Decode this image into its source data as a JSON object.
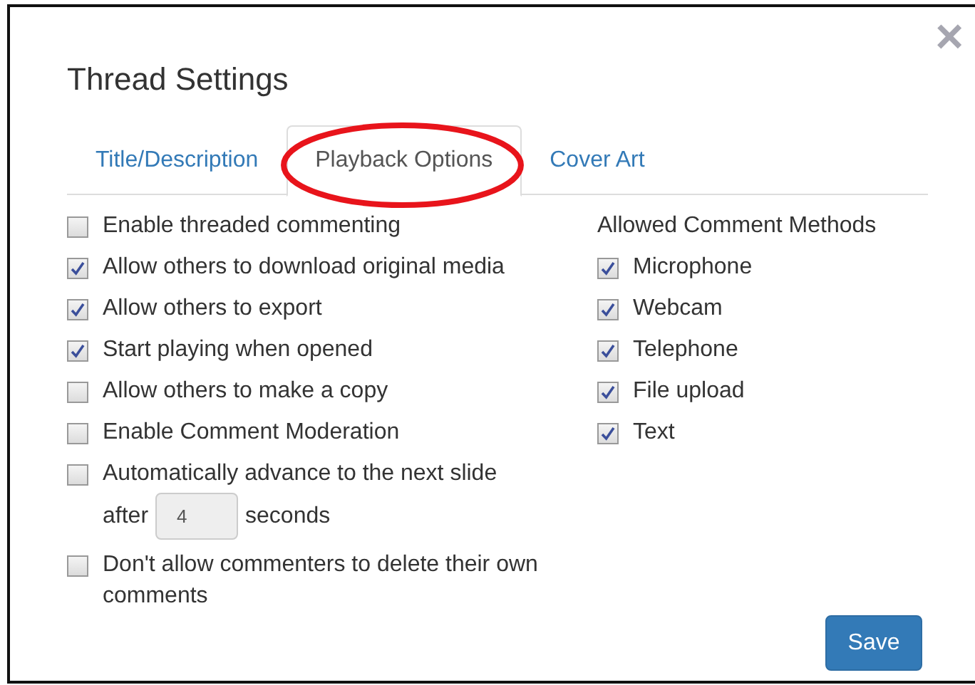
{
  "dialog": {
    "title": "Thread Settings",
    "close": "×"
  },
  "tabs": [
    {
      "label": "Title/Description",
      "selected": false,
      "circled": false
    },
    {
      "label": "Playback Options",
      "selected": true,
      "circled": true
    },
    {
      "label": "Cover Art",
      "selected": false,
      "circled": false
    }
  ],
  "options": [
    {
      "kind": "checkbox",
      "label": "Enable threaded commenting",
      "checked": false
    },
    {
      "kind": "checkbox",
      "label": "Allow others to download original media",
      "checked": true
    },
    {
      "kind": "checkbox",
      "label": "Allow others to export",
      "checked": true
    },
    {
      "kind": "checkbox",
      "label": "Start playing when opened",
      "checked": true
    },
    {
      "kind": "checkbox",
      "label": "Allow others to make a copy",
      "checked": false
    },
    {
      "kind": "checkbox",
      "label": "Enable Comment Moderation",
      "checked": false
    },
    {
      "kind": "interval",
      "label": "Automatically advance to the next slide",
      "before": "after",
      "value": "4",
      "after": "seconds",
      "checked": false
    },
    {
      "kind": "checkbox",
      "label": "Don't allow commenters to delete their own comments",
      "checked": false
    }
  ],
  "comment_methods": {
    "heading": "Allowed Comment Methods",
    "items": [
      {
        "label": "Microphone",
        "checked": true
      },
      {
        "label": "Webcam",
        "checked": true
      },
      {
        "label": "Telephone",
        "checked": true
      },
      {
        "label": "File upload",
        "checked": true
      },
      {
        "label": "Text",
        "checked": true
      }
    ]
  },
  "buttons": [
    {
      "label": "Save"
    }
  ]
}
